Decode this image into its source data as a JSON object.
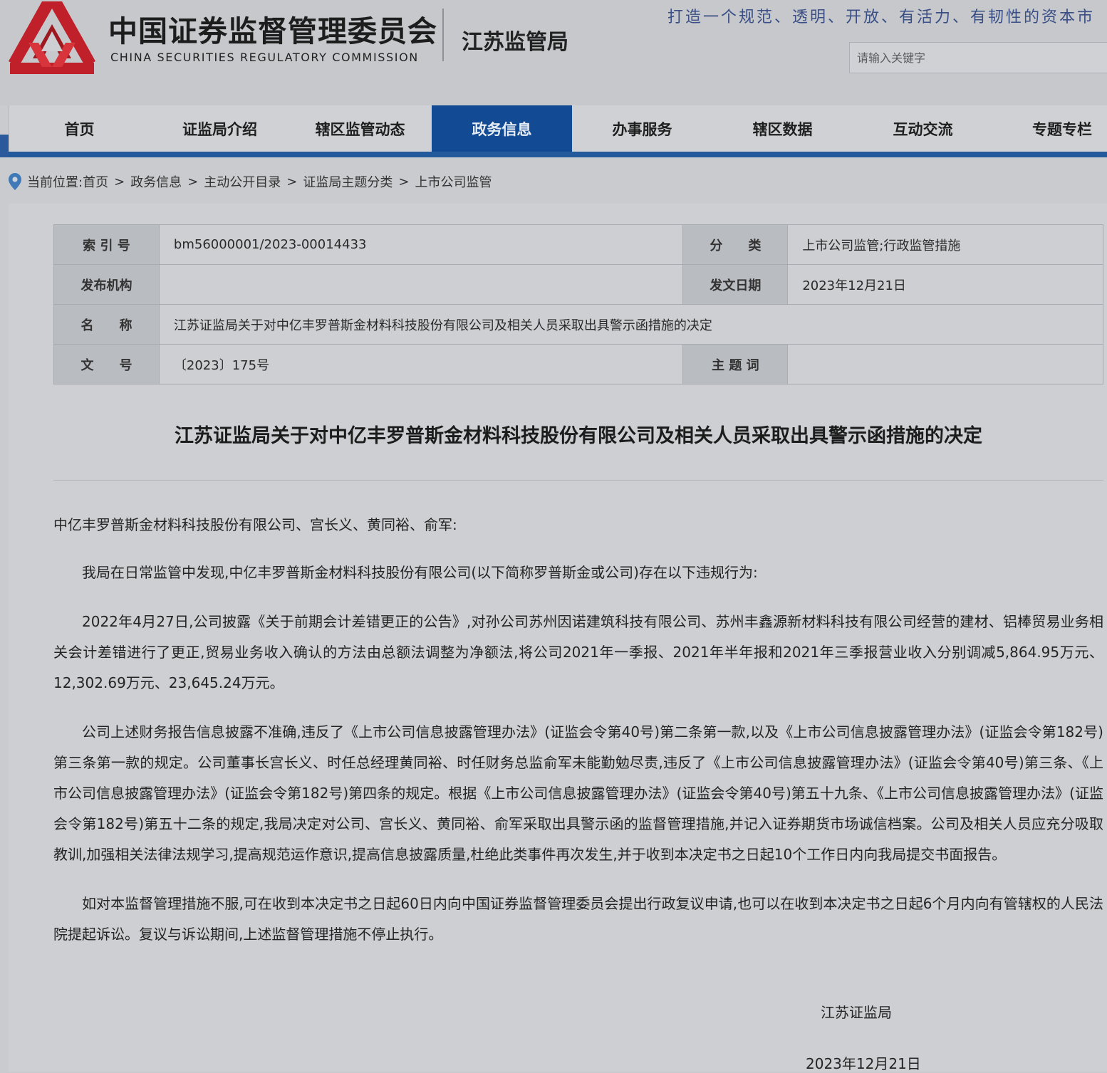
{
  "header": {
    "org_name_cn": "中国证券监督管理委员会",
    "org_name_en": "CHINA SECURITIES REGULATORY COMMISSION",
    "bureau_name": "江苏监管局",
    "slogan": "打造一个规范、透明、开放、有活力、有韧性的资本市",
    "search_placeholder": "请输入关键字"
  },
  "nav": {
    "items": [
      {
        "label": "首页"
      },
      {
        "label": "证监局介绍"
      },
      {
        "label": "辖区监管动态"
      },
      {
        "label": "政务信息"
      },
      {
        "label": "办事服务"
      },
      {
        "label": "辖区数据"
      },
      {
        "label": "互动交流"
      },
      {
        "label": "专题专栏"
      }
    ],
    "active_index": 3
  },
  "breadcrumb": {
    "prefix": "当前位置:",
    "items": [
      "首页",
      "政务信息",
      "主动公开目录",
      "证监局主题分类"
    ],
    "current": "上市公司监管",
    "separator": ">"
  },
  "meta": {
    "index_no_label": "索 引 号",
    "index_no": "bm56000001/2023-00014433",
    "category_label": "分　　类",
    "category": "上市公司监管;行政监管措施",
    "publisher_label": "发布机构",
    "publisher": "",
    "date_label": "发文日期",
    "date": "2023年12月21日",
    "name_label": "名　　称",
    "name": "江苏证监局关于对中亿丰罗普斯金材料科技股份有限公司及相关人员采取出具警示函措施的决定",
    "doc_no_label": "文　　号",
    "doc_no": "〔2023〕175号",
    "keywords_label": "主 题 词",
    "keywords": ""
  },
  "document": {
    "title": "江苏证监局关于对中亿丰罗普斯金材料科技股份有限公司及相关人员采取出具警示函措施的决定",
    "salutation": "中亿丰罗普斯金材料科技股份有限公司、宫长义、黄同裕、俞军:",
    "paragraphs": [
      "我局在日常监管中发现,中亿丰罗普斯金材料科技股份有限公司(以下简称罗普斯金或公司)存在以下违规行为:",
      "2022年4月27日,公司披露《关于前期会计差错更正的公告》,对孙公司苏州因诺建筑科技有限公司、苏州丰鑫源新材料科技有限公司经营的建材、铝棒贸易业务相关会计差错进行了更正,贸易业务收入确认的方法由总额法调整为净额法,将公司2021年一季报、2021年半年报和2021年三季报营业收入分别调减5,864.95万元、12,302.69万元、23,645.24万元。",
      "公司上述财务报告信息披露不准确,违反了《上市公司信息披露管理办法》(证监会令第40号)第二条第一款,以及《上市公司信息披露管理办法》(证监会令第182号)第三条第一款的规定。公司董事长宫长义、时任总经理黄同裕、时任财务总监俞军未能勤勉尽责,违反了《上市公司信息披露管理办法》(证监会令第40号)第三条、《上市公司信息披露管理办法》(证监会令第182号)第四条的规定。根据《上市公司信息披露管理办法》(证监会令第40号)第五十九条、《上市公司信息披露管理办法》(证监会令第182号)第五十二条的规定,我局决定对公司、宫长义、黄同裕、俞军采取出具警示函的监督管理措施,并记入证券期货市场诚信档案。公司及相关人员应充分吸取教训,加强相关法律法规学习,提高规范运作意识,提高信息披露质量,杜绝此类事件再次发生,并于收到本决定书之日起10个工作日内向我局提交书面报告。",
      "如对本监督管理措施不服,可在收到本决定书之日起60日内向中国证券监督管理委员会提出行政复议申请,也可以在收到本决定书之日起6个月内向有管辖权的人民法院提起诉讼。复议与诉讼期间,上述监督管理措施不停止执行。"
    ],
    "signature_org": "江苏证监局",
    "signature_date": "2023年12月21日"
  },
  "colors": {
    "logo_red": "#c0202a",
    "nav_active": "#124b93",
    "nav_underline": "#225a9b",
    "slogan": "#3a4f86"
  }
}
